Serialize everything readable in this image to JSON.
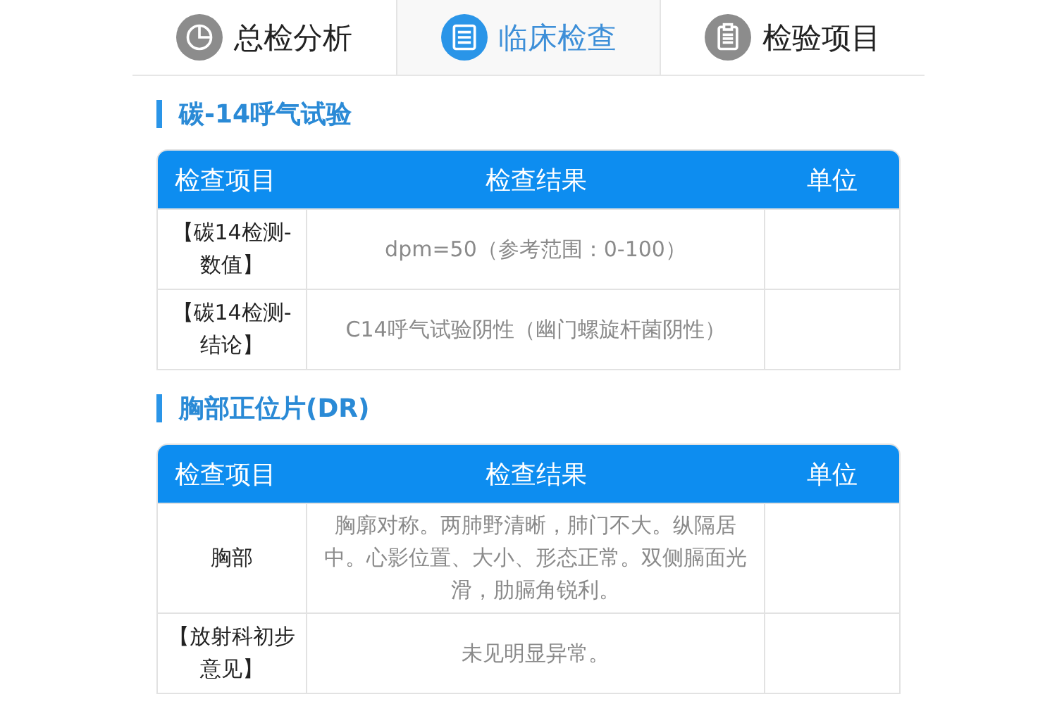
{
  "tabs": [
    {
      "label": "总检分析",
      "kind": "chart",
      "selected": false
    },
    {
      "label": "临床检查",
      "kind": "list",
      "selected": true
    },
    {
      "label": "检验项目",
      "kind": "clipboard",
      "selected": false
    }
  ],
  "sections": [
    {
      "title": "碳-14呼气试验",
      "columns": [
        "检查项目",
        "检查结果",
        "单位"
      ],
      "rows": [
        {
          "item": "【碳14检测-数值】",
          "result": "dpm=50（参考范围：0-100）"
        },
        {
          "item": "【碳14检测-结论】",
          "result": "C14呼气试验阴性（幽门螺旋杆菌阴性）"
        }
      ]
    },
    {
      "title": "胸部正位片(DR)",
      "columns": [
        "检查项目",
        "检查结果",
        "单位"
      ],
      "rows": [
        {
          "item": "胸部",
          "result": "胸廓对称。两肺野清晰，肺门不大。纵隔居中。心影位置、大小、形态正常。双侧膈面光滑，肋膈角锐利。"
        },
        {
          "item": "【放射科初步意见】",
          "result": "未见明显异常。"
        }
      ]
    }
  ]
}
